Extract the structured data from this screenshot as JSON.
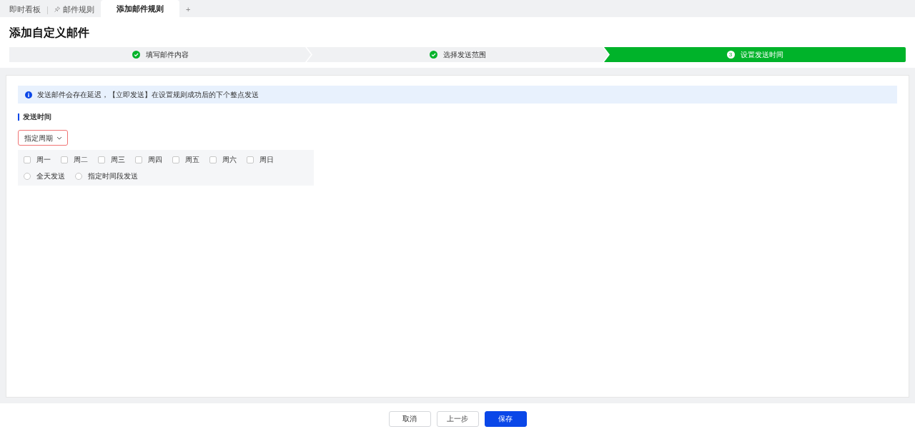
{
  "tabs": [
    {
      "label": "即时看板",
      "selected": false,
      "pinned": false
    },
    {
      "label": "邮件规则",
      "selected": false,
      "pinned": true
    },
    {
      "label": "添加邮件规则",
      "selected": true,
      "pinned": false
    }
  ],
  "add_tab": "+",
  "page_title": "添加自定义邮件",
  "steps": [
    {
      "label": "填写邮件内容",
      "done": true,
      "current": false
    },
    {
      "label": "选择发送范围",
      "done": true,
      "current": false
    },
    {
      "label": "设置发送时间",
      "done": false,
      "current": true,
      "number": "3"
    }
  ],
  "notice": "发送邮件会存在延迟，【立即发送】在设置规则成功后的下个整点发送",
  "section_title": "发送时间",
  "period_select": {
    "value": "指定周期"
  },
  "weekdays": [
    {
      "label": "周一",
      "checked": false
    },
    {
      "label": "周二",
      "checked": false
    },
    {
      "label": "周三",
      "checked": false
    },
    {
      "label": "周四",
      "checked": false
    },
    {
      "label": "周五",
      "checked": false
    },
    {
      "label": "周六",
      "checked": false
    },
    {
      "label": "周日",
      "checked": false
    }
  ],
  "send_modes": [
    {
      "label": "全天发送",
      "selected": false
    },
    {
      "label": "指定时间段发送",
      "selected": false
    }
  ],
  "buttons": [
    {
      "label": "取消",
      "kind": "default"
    },
    {
      "label": "上一步",
      "kind": "default"
    },
    {
      "label": "保存",
      "kind": "primary"
    }
  ]
}
